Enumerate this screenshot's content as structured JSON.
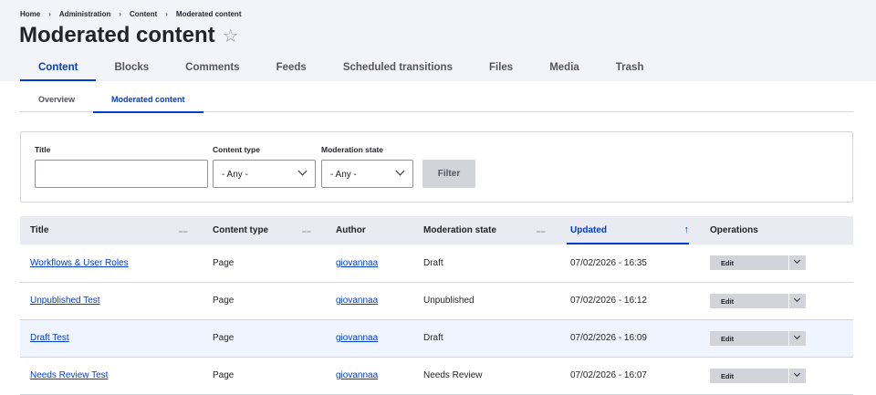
{
  "breadcrumb": [
    "Home",
    "Administration",
    "Content",
    "Moderated content"
  ],
  "page": {
    "title": "Moderated content",
    "star": "☆"
  },
  "primary_tabs": [
    "Content",
    "Blocks",
    "Comments",
    "Feeds",
    "Scheduled transitions",
    "Files",
    "Media",
    "Trash"
  ],
  "primary_active": "Content",
  "secondary_tabs": [
    "Overview",
    "Moderated content"
  ],
  "secondary_active": "Moderated content",
  "filters": {
    "title_label": "Title",
    "title_value": "",
    "content_type_label": "Content type",
    "content_type_value": "- Any -",
    "moderation_state_label": "Moderation state",
    "moderation_state_value": "- Any -",
    "filter_button": "Filter"
  },
  "table": {
    "headers": [
      "Title",
      "Content type",
      "Author",
      "Moderation state",
      "Updated",
      "Operations"
    ],
    "sorted_column": "Updated",
    "sort_arrow": "↑",
    "sort_icon": "⩵",
    "rows": [
      {
        "title": "Workflows & User Roles",
        "content_type": "Page",
        "author": "giovannaa",
        "state": "Draft",
        "updated": "07/02/2026 - 16:35",
        "op": "Edit"
      },
      {
        "title": "Unpublished Test",
        "content_type": "Page",
        "author": "giovannaa",
        "state": "Unpublished",
        "updated": "07/02/2026 - 16:12",
        "op": "Edit"
      },
      {
        "title": "Draft Test",
        "content_type": "Page",
        "author": "giovannaa",
        "state": "Draft",
        "updated": "07/02/2026 - 16:09",
        "op": "Edit"
      },
      {
        "title": "Needs Review Test",
        "content_type": "Page",
        "author": "giovannaa",
        "state": "Needs Review",
        "updated": "07/02/2026 - 16:07",
        "op": "Edit"
      }
    ]
  },
  "colors": {
    "accent": "#003ecc",
    "header_bg": "#f3f4f9",
    "row_highlight": "#f0f4ff"
  }
}
